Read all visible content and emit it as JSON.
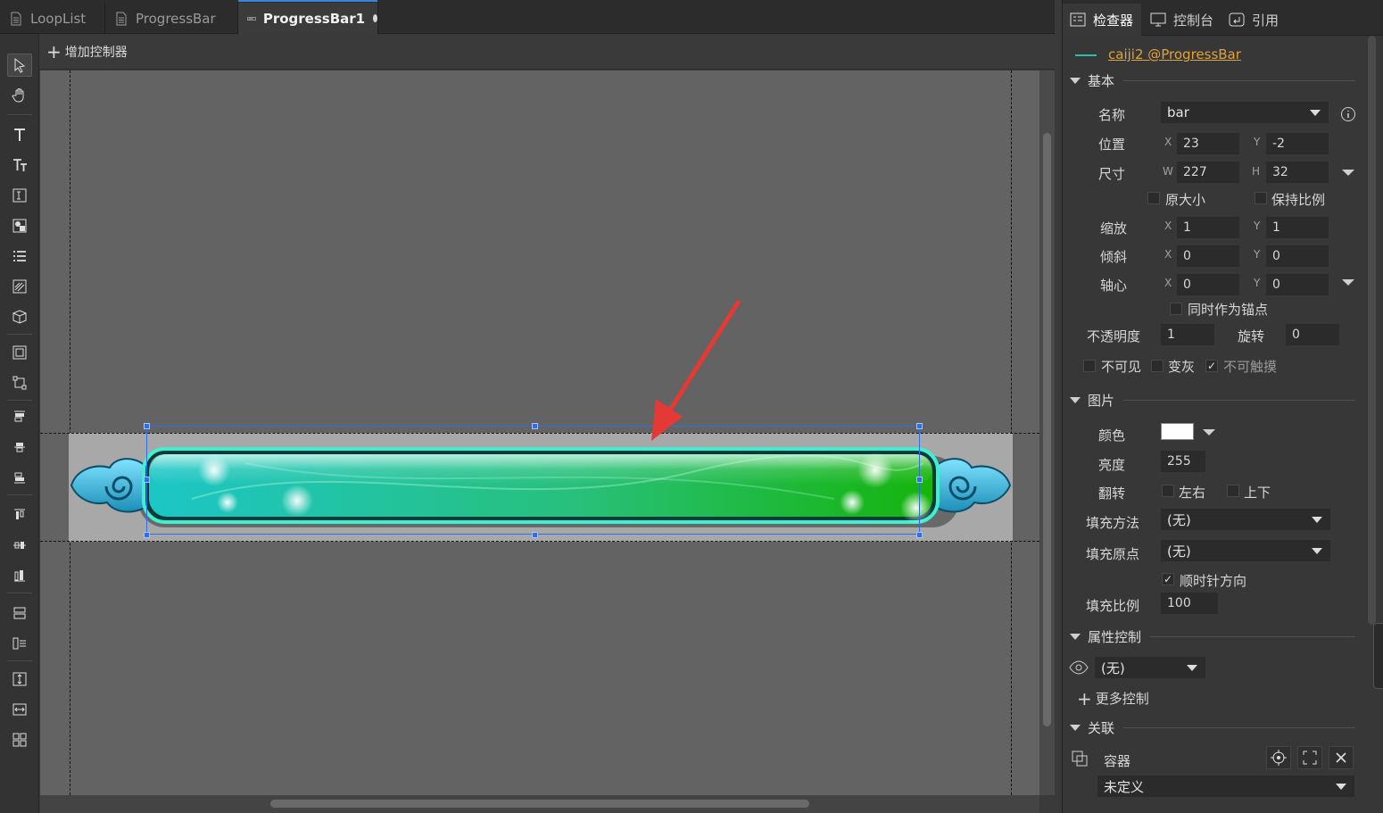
{
  "tabs": [
    {
      "label": "LoopList",
      "icon": "document-icon"
    },
    {
      "label": "ProgressBar",
      "icon": "document-icon"
    },
    {
      "label": "ProgressBar1",
      "icon": "progressbar-icon",
      "active": true,
      "modified": true
    }
  ],
  "toolbar": {
    "tools": [
      "select-arrow-icon",
      "hand-pan-icon",
      "text-icon",
      "rich-text-icon",
      "input-text-icon",
      "image-icon",
      "list-icon",
      "progressbar-icon",
      "model-3d-icon",
      "component-icon",
      "relation-icon",
      "align-top-icon",
      "align-vcenter-icon",
      "align-bottom-icon",
      "align-left-icon",
      "align-hcenter-icon",
      "align-right-icon",
      "distribute-v-icon",
      "distribute-h-icon",
      "same-height-icon",
      "same-width-icon",
      "grid-icon"
    ]
  },
  "addbar": {
    "label": "增加控制器"
  },
  "inspector": {
    "tabs": [
      {
        "label": "检查器",
        "icon": "inspector-icon"
      },
      {
        "label": "控制台",
        "icon": "console-icon"
      },
      {
        "label": "引用",
        "icon": "reference-icon"
      }
    ],
    "object_link": "caiji2 @ProgressBar",
    "sections": {
      "basic": "基本",
      "image": "图片",
      "property_control": "属性控制",
      "relation": "关联"
    },
    "basic": {
      "name_label": "名称",
      "name_value": "bar",
      "position_label": "位置",
      "x": "23",
      "y": "-2",
      "size_label": "尺寸",
      "w": "227",
      "h": "32",
      "original_size": "原大小",
      "keep_ratio": "保持比例",
      "scale_label": "缩放",
      "scale_x": "1",
      "scale_y": "1",
      "skew_label": "倾斜",
      "skew_x": "0",
      "skew_y": "0",
      "pivot_label": "轴心",
      "pivot_x": "0",
      "pivot_y": "0",
      "pivot_as_anchor": "同时作为锚点",
      "opacity_label": "不透明度",
      "opacity": "1",
      "rotation_label": "旋转",
      "rotation": "0",
      "invisible": "不可见",
      "grayed": "变灰",
      "untouchable": "不可触摸"
    },
    "image": {
      "color_label": "颜色",
      "color": "#ffffff",
      "brightness_label": "亮度",
      "brightness": "255",
      "flip_label": "翻转",
      "flip_lr": "左右",
      "flip_ud": "上下",
      "fill_method_label": "填充方法",
      "fill_method": "(无)",
      "fill_origin_label": "填充原点",
      "fill_origin": "(无)",
      "clockwise": "顺时针方向",
      "fill_amount_label": "填充比例",
      "fill_amount": "100"
    },
    "property_control": {
      "value": "(无)",
      "more": "更多控制"
    },
    "relation": {
      "container_label": "容器",
      "target": "未定义"
    },
    "axis": {
      "x": "X",
      "y": "Y",
      "w": "W",
      "h": "H"
    }
  },
  "colors": {
    "accent": "#3b84dc",
    "link": "#e0a23a",
    "selection": "#2f6fe0",
    "arrow": "#e53935"
  }
}
